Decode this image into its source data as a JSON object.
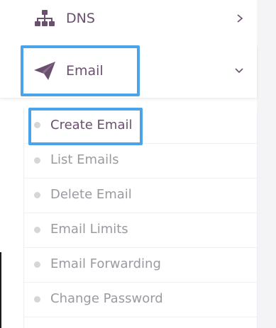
{
  "nav": {
    "dns": {
      "label": "DNS",
      "icon": "sitemap-icon",
      "chevron": "chevron-right-icon"
    },
    "email": {
      "label": "Email",
      "icon": "paper-plane-icon",
      "chevron": "chevron-down-icon",
      "expanded": true
    },
    "email_submenu": [
      {
        "label": "Create Email",
        "active": true
      },
      {
        "label": "List Emails",
        "active": false
      },
      {
        "label": "Delete Email",
        "active": false
      },
      {
        "label": "Email Limits",
        "active": false
      },
      {
        "label": "Email Forwarding",
        "active": false
      },
      {
        "label": "Change Password",
        "active": false
      }
    ]
  },
  "colors": {
    "label_primary": "#6b4f6f",
    "label_secondary": "#9a9aa1",
    "highlight": "#4ba3ea",
    "bullet": "#d6d6d9"
  }
}
